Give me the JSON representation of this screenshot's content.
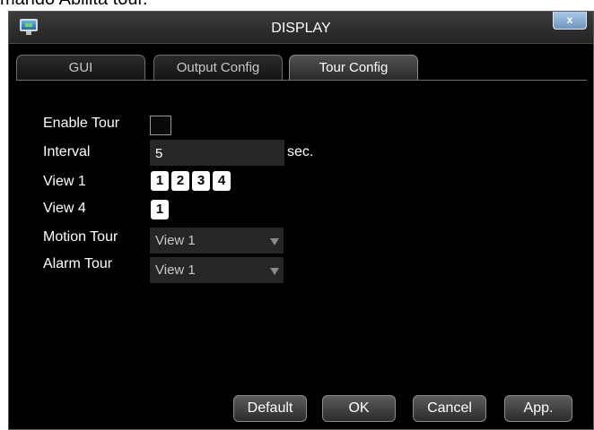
{
  "caption": "mando Abilita tour.",
  "window": {
    "title": "DISPLAY",
    "close_glyph": "x",
    "icon": "monitor-icon"
  },
  "tabs": [
    {
      "label": "GUI",
      "active": false
    },
    {
      "label": "Output Config",
      "active": false
    },
    {
      "label": "Tour Config",
      "active": true
    }
  ],
  "form": {
    "enable_tour": {
      "label": "Enable Tour",
      "checked": false
    },
    "interval": {
      "label": "Interval",
      "value": "5",
      "unit": "sec."
    },
    "view1": {
      "label": "View 1",
      "options": [
        "1",
        "2",
        "3",
        "4"
      ]
    },
    "view4": {
      "label": "View 4",
      "options": [
        "1"
      ]
    },
    "motion_tour": {
      "label": "Motion Tour",
      "value": "View 1"
    },
    "alarm_tour": {
      "label": "Alarm Tour",
      "value": "View 1"
    }
  },
  "buttons": {
    "default": "Default",
    "ok": "OK",
    "cancel": "Cancel",
    "apply": "App."
  },
  "colors": {
    "window_bg": "#000000",
    "titlebar": "#2e2e2e",
    "close_button": "#8fb0d6",
    "field_bg": "#262626"
  }
}
